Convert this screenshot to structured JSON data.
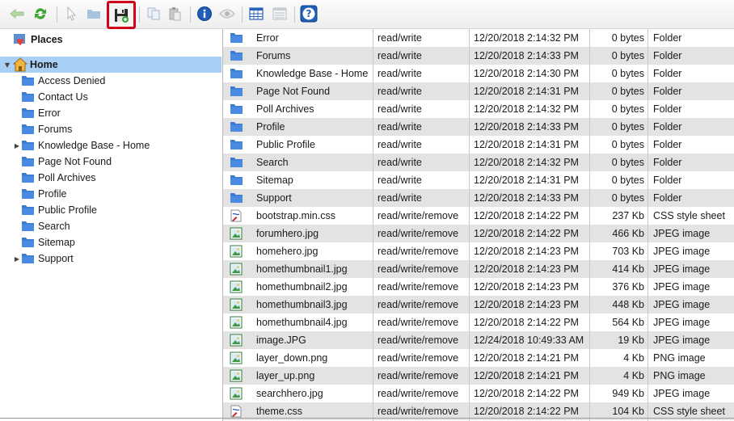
{
  "toolbar": {
    "buttons": [
      {
        "name": "back-button",
        "icon": "arrow-left-icon",
        "enabled": false
      },
      {
        "name": "refresh-button",
        "icon": "refresh-icon",
        "enabled": true
      },
      {
        "name": "select-button",
        "icon": "cursor-icon",
        "enabled": false
      },
      {
        "name": "open-folder-button",
        "icon": "folder-open-icon",
        "enabled": false
      },
      {
        "name": "save-button",
        "icon": "floppy-disk-icon",
        "enabled": true,
        "highlighted": true
      },
      {
        "name": "copy-button",
        "icon": "copy-icon",
        "enabled": false
      },
      {
        "name": "paste-button",
        "icon": "paste-icon",
        "enabled": false
      },
      {
        "name": "info-button",
        "icon": "info-icon",
        "enabled": true
      },
      {
        "name": "preview-button",
        "icon": "eye-icon",
        "enabled": false
      },
      {
        "name": "details-view-button",
        "icon": "grid-view-icon",
        "enabled": true
      },
      {
        "name": "list-view-button",
        "icon": "list-view-icon",
        "enabled": false
      },
      {
        "name": "help-button",
        "icon": "help-icon",
        "enabled": true
      }
    ],
    "highlight_color": "#d0021b"
  },
  "tree": {
    "places_label": "Places",
    "home_label": "Home",
    "items": [
      {
        "label": "Access Denied",
        "expandable": false
      },
      {
        "label": "Contact Us",
        "expandable": false
      },
      {
        "label": "Error",
        "expandable": false
      },
      {
        "label": "Forums",
        "expandable": false
      },
      {
        "label": "Knowledge Base - Home",
        "expandable": true
      },
      {
        "label": "Page Not Found",
        "expandable": false
      },
      {
        "label": "Poll Archives",
        "expandable": false
      },
      {
        "label": "Profile",
        "expandable": false
      },
      {
        "label": "Public Profile",
        "expandable": false
      },
      {
        "label": "Search",
        "expandable": false
      },
      {
        "label": "Sitemap",
        "expandable": false
      },
      {
        "label": "Support",
        "expandable": true
      }
    ]
  },
  "files": [
    {
      "name": "Error",
      "perm": "read/write",
      "date": "12/20/2018 2:14:32 PM",
      "size": "0 bytes",
      "type": "Folder",
      "icon": "folder-icon"
    },
    {
      "name": "Forums",
      "perm": "read/write",
      "date": "12/20/2018 2:14:33 PM",
      "size": "0 bytes",
      "type": "Folder",
      "icon": "folder-icon"
    },
    {
      "name": "Knowledge Base - Home",
      "perm": "read/write",
      "date": "12/20/2018 2:14:30 PM",
      "size": "0 bytes",
      "type": "Folder",
      "icon": "folder-icon"
    },
    {
      "name": "Page Not Found",
      "perm": "read/write",
      "date": "12/20/2018 2:14:31 PM",
      "size": "0 bytes",
      "type": "Folder",
      "icon": "folder-icon"
    },
    {
      "name": "Poll Archives",
      "perm": "read/write",
      "date": "12/20/2018 2:14:32 PM",
      "size": "0 bytes",
      "type": "Folder",
      "icon": "folder-icon"
    },
    {
      "name": "Profile",
      "perm": "read/write",
      "date": "12/20/2018 2:14:33 PM",
      "size": "0 bytes",
      "type": "Folder",
      "icon": "folder-icon"
    },
    {
      "name": "Public Profile",
      "perm": "read/write",
      "date": "12/20/2018 2:14:31 PM",
      "size": "0 bytes",
      "type": "Folder",
      "icon": "folder-icon"
    },
    {
      "name": "Search",
      "perm": "read/write",
      "date": "12/20/2018 2:14:32 PM",
      "size": "0 bytes",
      "type": "Folder",
      "icon": "folder-icon"
    },
    {
      "name": "Sitemap",
      "perm": "read/write",
      "date": "12/20/2018 2:14:31 PM",
      "size": "0 bytes",
      "type": "Folder",
      "icon": "folder-icon"
    },
    {
      "name": "Support",
      "perm": "read/write",
      "date": "12/20/2018 2:14:33 PM",
      "size": "0 bytes",
      "type": "Folder",
      "icon": "folder-icon"
    },
    {
      "name": "bootstrap.min.css",
      "perm": "read/write/remove",
      "date": "12/20/2018 2:14:22 PM",
      "size": "237 Kb",
      "type": "CSS style sheet",
      "icon": "css-file-icon"
    },
    {
      "name": "forumhero.jpg",
      "perm": "read/write/remove",
      "date": "12/20/2018 2:14:22 PM",
      "size": "466 Kb",
      "type": "JPEG image",
      "icon": "image-file-icon"
    },
    {
      "name": "homehero.jpg",
      "perm": "read/write/remove",
      "date": "12/20/2018 2:14:23 PM",
      "size": "703 Kb",
      "type": "JPEG image",
      "icon": "image-file-icon"
    },
    {
      "name": "homethumbnail1.jpg",
      "perm": "read/write/remove",
      "date": "12/20/2018 2:14:23 PM",
      "size": "414 Kb",
      "type": "JPEG image",
      "icon": "image-file-icon"
    },
    {
      "name": "homethumbnail2.jpg",
      "perm": "read/write/remove",
      "date": "12/20/2018 2:14:23 PM",
      "size": "376 Kb",
      "type": "JPEG image",
      "icon": "image-file-icon"
    },
    {
      "name": "homethumbnail3.jpg",
      "perm": "read/write/remove",
      "date": "12/20/2018 2:14:23 PM",
      "size": "448 Kb",
      "type": "JPEG image",
      "icon": "image-file-icon"
    },
    {
      "name": "homethumbnail4.jpg",
      "perm": "read/write/remove",
      "date": "12/20/2018 2:14:22 PM",
      "size": "564 Kb",
      "type": "JPEG image",
      "icon": "image-file-icon"
    },
    {
      "name": "image.JPG",
      "perm": "read/write/remove",
      "date": "12/24/2018 10:49:33 AM",
      "size": "19 Kb",
      "type": "JPEG image",
      "icon": "image-file-icon"
    },
    {
      "name": "layer_down.png",
      "perm": "read/write/remove",
      "date": "12/20/2018 2:14:21 PM",
      "size": "4 Kb",
      "type": "PNG image",
      "icon": "image-file-icon"
    },
    {
      "name": "layer_up.png",
      "perm": "read/write/remove",
      "date": "12/20/2018 2:14:21 PM",
      "size": "4 Kb",
      "type": "PNG image",
      "icon": "image-file-icon"
    },
    {
      "name": "searchhero.jpg",
      "perm": "read/write/remove",
      "date": "12/20/2018 2:14:22 PM",
      "size": "949 Kb",
      "type": "JPEG image",
      "icon": "image-file-icon"
    },
    {
      "name": "theme.css",
      "perm": "read/write/remove",
      "date": "12/20/2018 2:14:22 PM",
      "size": "104 Kb",
      "type": "CSS style sheet",
      "icon": "css-file-icon"
    }
  ],
  "colors": {
    "folder": "#3a7bd5",
    "selection": "#a8d0f5",
    "alt_row": "#e3e3e3"
  }
}
